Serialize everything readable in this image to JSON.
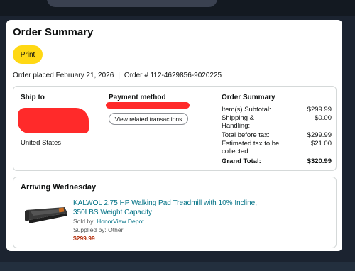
{
  "page": {
    "title": "Order Summary",
    "print_label": "Print",
    "order_placed": "Order placed February 21, 2026",
    "order_number": "Order # 112-4629856-9020225"
  },
  "ship_to": {
    "heading": "Ship to",
    "country": "United States"
  },
  "payment": {
    "heading": "Payment method",
    "transactions_button": "View related transactions"
  },
  "summary": {
    "heading": "Order Summary",
    "rows": [
      {
        "label": "Item(s) Subtotal:",
        "value": "$299.99"
      },
      {
        "label": "Shipping & Handling:",
        "value": "$0.00"
      },
      {
        "label": "Total before tax:",
        "value": "$299.99"
      },
      {
        "label": "Estimated tax to be collected:",
        "value": "$21.00"
      },
      {
        "label": "Grand Total:",
        "value": "$320.99"
      }
    ]
  },
  "shipment": {
    "arriving": "Arriving Wednesday",
    "product_title": "KALWOL 2.75 HP Walking Pad Treadmill with 10% Incline, 350LBS Weight Capacity",
    "sold_by_label": "Sold by:",
    "sold_by": "HonorView Depot",
    "supplied_by": "Supplied by: Other",
    "price": "$299.99"
  },
  "colors": {
    "print_button": "#ffd814",
    "link": "#007185",
    "price": "#b12704",
    "redaction": "#ff2a2a"
  }
}
